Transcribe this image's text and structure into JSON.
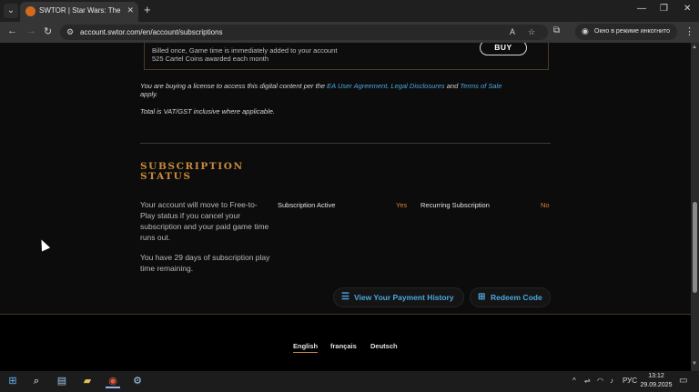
{
  "browser": {
    "tab_title": "SWTOR | Star Wars: The Old Re",
    "tab_close": "✕",
    "new_tab": "+",
    "url": "account.swtor.com/en/account/subscriptions",
    "incognito_label": "Окно в режиме инкогнито",
    "window_controls": {
      "minimize": "—",
      "maximize": "❐",
      "close": "✕"
    },
    "nav": {
      "back": "←",
      "forward": "→",
      "reload": "↻"
    },
    "icons": {
      "tab_list": "chevron-down-icon",
      "site_info": "tune-icon",
      "translate": "translate-icon",
      "bookmark": "star-icon",
      "extensions": "puzzle-icon",
      "incognito": "incognito-icon",
      "menu": "more-vert-icon"
    }
  },
  "offer": {
    "cut_text": "[ · · · · · · · ]",
    "line1": "Billed once, Game time is immediately added to your account",
    "line2": "525 Cartel Coins awarded each month",
    "buy_label": "BUY"
  },
  "legal": {
    "prefix": "You are buying a license to access this digital content per the",
    "link1": "EA User Agreement",
    "sep": ".",
    "link2": "Legal Disclosures",
    "and": "and",
    "link3": "Terms of Sale",
    "suffix": "apply.",
    "vat": "Total is VAT/GST inclusive where applicable."
  },
  "subscription": {
    "heading": "SUBSCRIPTION STATUS",
    "move_text": "Your account will move to Free-to-Play status if you cancel your subscription and your paid game time runs out.",
    "days_text": "You have 29 days of subscription play time remaining.",
    "active_label": "Subscription Active",
    "active_value": "Yes",
    "recurring_label": "Recurring Subscription",
    "recurring_value": "No",
    "payment_history_label": "View Your Payment History",
    "redeem_label": "Redeem Code"
  },
  "footer": {
    "languages": [
      "English",
      "français",
      "Deutsch"
    ],
    "active_language": "English"
  },
  "taskbar": {
    "lang": "РУС",
    "time": "13:12",
    "date": "29.09.2025"
  },
  "colors": {
    "accent_gold": "#c98a3d",
    "link_blue": "#4ba7e0",
    "value_orange": "#d9822b"
  }
}
